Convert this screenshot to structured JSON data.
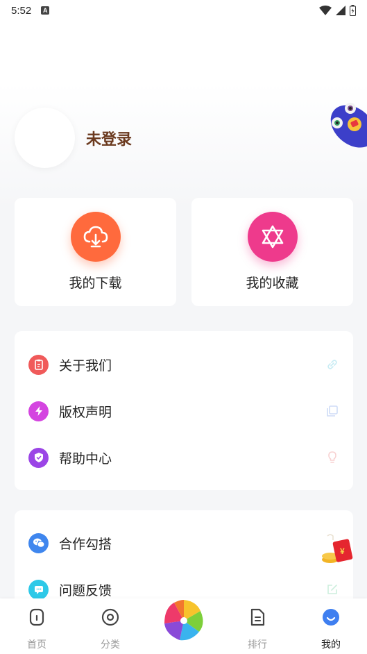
{
  "status_bar": {
    "time": "5:52",
    "notif_glyph": "A"
  },
  "profile": {
    "login_label": "未登录"
  },
  "quick_actions": [
    {
      "label": "我的下载",
      "icon": "cloud-download-icon",
      "color": "#ff6a3d"
    },
    {
      "label": "我的收藏",
      "icon": "star-of-david-icon",
      "color": "#ee3a8c"
    }
  ],
  "menu_group_1": [
    {
      "label": "关于我们",
      "lead_icon": "clipboard-icon",
      "lead_color": "#f05a5a",
      "trail_icon": "link-icon"
    },
    {
      "label": "版权声明",
      "lead_icon": "lightning-icon",
      "lead_color": "#d445e0",
      "trail_icon": "copy-icon"
    },
    {
      "label": "帮助中心",
      "lead_icon": "shield-icon",
      "lead_color": "#9b45e6",
      "trail_icon": "bulb-icon"
    }
  ],
  "menu_group_2": [
    {
      "label": "合作勾搭",
      "lead_icon": "wechat-icon",
      "lead_color": "#3f86ee",
      "trail_icon": "red-packet-icon"
    },
    {
      "label": "问题反馈",
      "lead_icon": "chat-bubble-icon",
      "lead_color": "#2ec9e8",
      "trail_icon": "edit-icon"
    }
  ],
  "tabs": [
    {
      "label": "首页",
      "icon": "home-icon"
    },
    {
      "label": "分类",
      "icon": "category-icon"
    },
    {
      "label": "",
      "icon": "pinwheel-icon"
    },
    {
      "label": "排行",
      "icon": "ranking-icon"
    },
    {
      "label": "我的",
      "icon": "profile-icon",
      "active": true
    }
  ],
  "red_packet_text": "¥"
}
